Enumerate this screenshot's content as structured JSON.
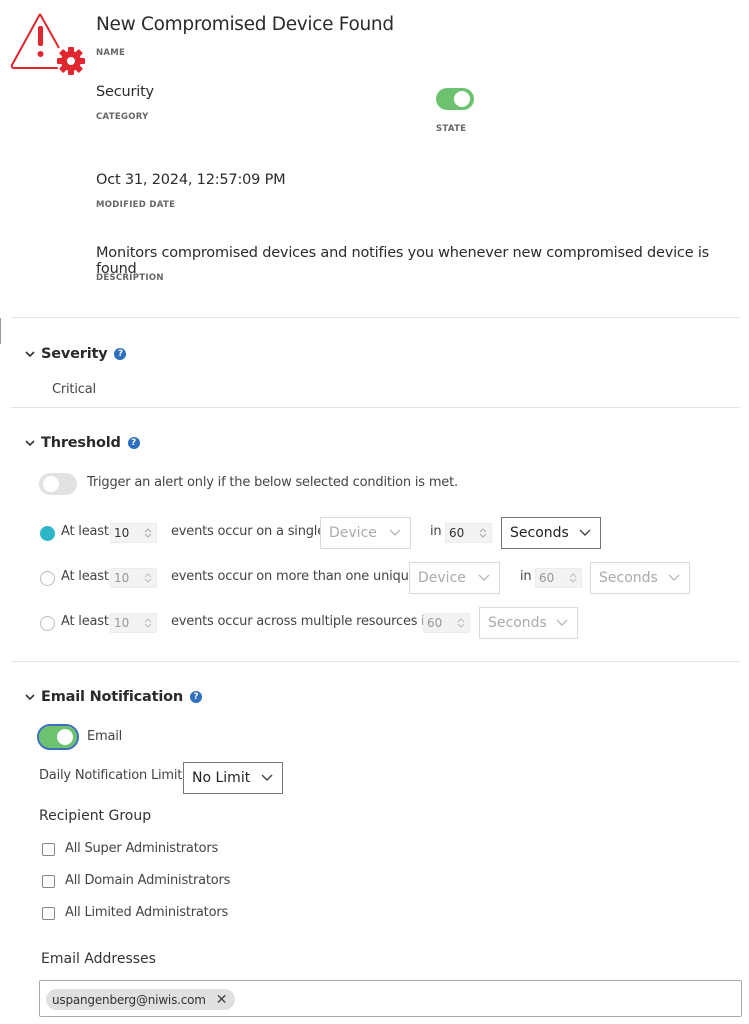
{
  "header": {
    "icon": "alert-triangle-gear-icon",
    "name_value": "New Compromised Device Found",
    "name_label": "NAME",
    "category_value": "Security",
    "category_label": "CATEGORY",
    "state_label": "STATE",
    "state_on": true,
    "modified_value": "Oct 31, 2024, 12:57:09 PM",
    "modified_label": "MODIFIED DATE",
    "description_value": "Monitors compromised devices and notifies you whenever new compromised device is found",
    "description_label": "DESCRIPTION"
  },
  "colors": {
    "alert_red": "#e0262f",
    "toggle_on": "#6cc26f",
    "radio_selected": "#2bb7c9",
    "help_blue": "#2f6fbf"
  },
  "severity": {
    "title": "Severity",
    "help_icon": "?",
    "value": "Critical"
  },
  "threshold": {
    "title": "Threshold",
    "help_icon": "?",
    "toggle_label": "Trigger an alert only if the below selected condition is met.",
    "toggle_on": false,
    "rows": [
      {
        "selected": true,
        "prefix": "At least",
        "count": "10",
        "middle": "events occur on a single",
        "resource": "Device",
        "in_label": "in",
        "duration": "60",
        "unit": "Seconds"
      },
      {
        "selected": false,
        "prefix": "At least",
        "count": "10",
        "middle": "events occur on more than one unique",
        "resource": "Device",
        "in_label": "in",
        "duration": "60",
        "unit": "Seconds"
      },
      {
        "selected": false,
        "prefix": "At least",
        "count": "10",
        "middle": "events occur across multiple resources in",
        "duration": "60",
        "unit": "Seconds"
      }
    ]
  },
  "email_notification": {
    "title": "Email Notification",
    "help_icon": "?",
    "email_toggle_label": "Email",
    "email_toggle_on": true,
    "daily_limit_label": "Daily Notification Limit",
    "daily_limit_value": "No Limit",
    "recipient_group_label": "Recipient Group",
    "recipient_groups": [
      {
        "label": "All Super Administrators",
        "checked": false
      },
      {
        "label": "All Domain Administrators",
        "checked": false
      },
      {
        "label": "All Limited Administrators",
        "checked": false
      }
    ],
    "email_addresses_label": "Email Addresses",
    "email_addresses": [
      "uspangenberg@niwis.com"
    ],
    "remove_chip_glyph": "✕"
  }
}
